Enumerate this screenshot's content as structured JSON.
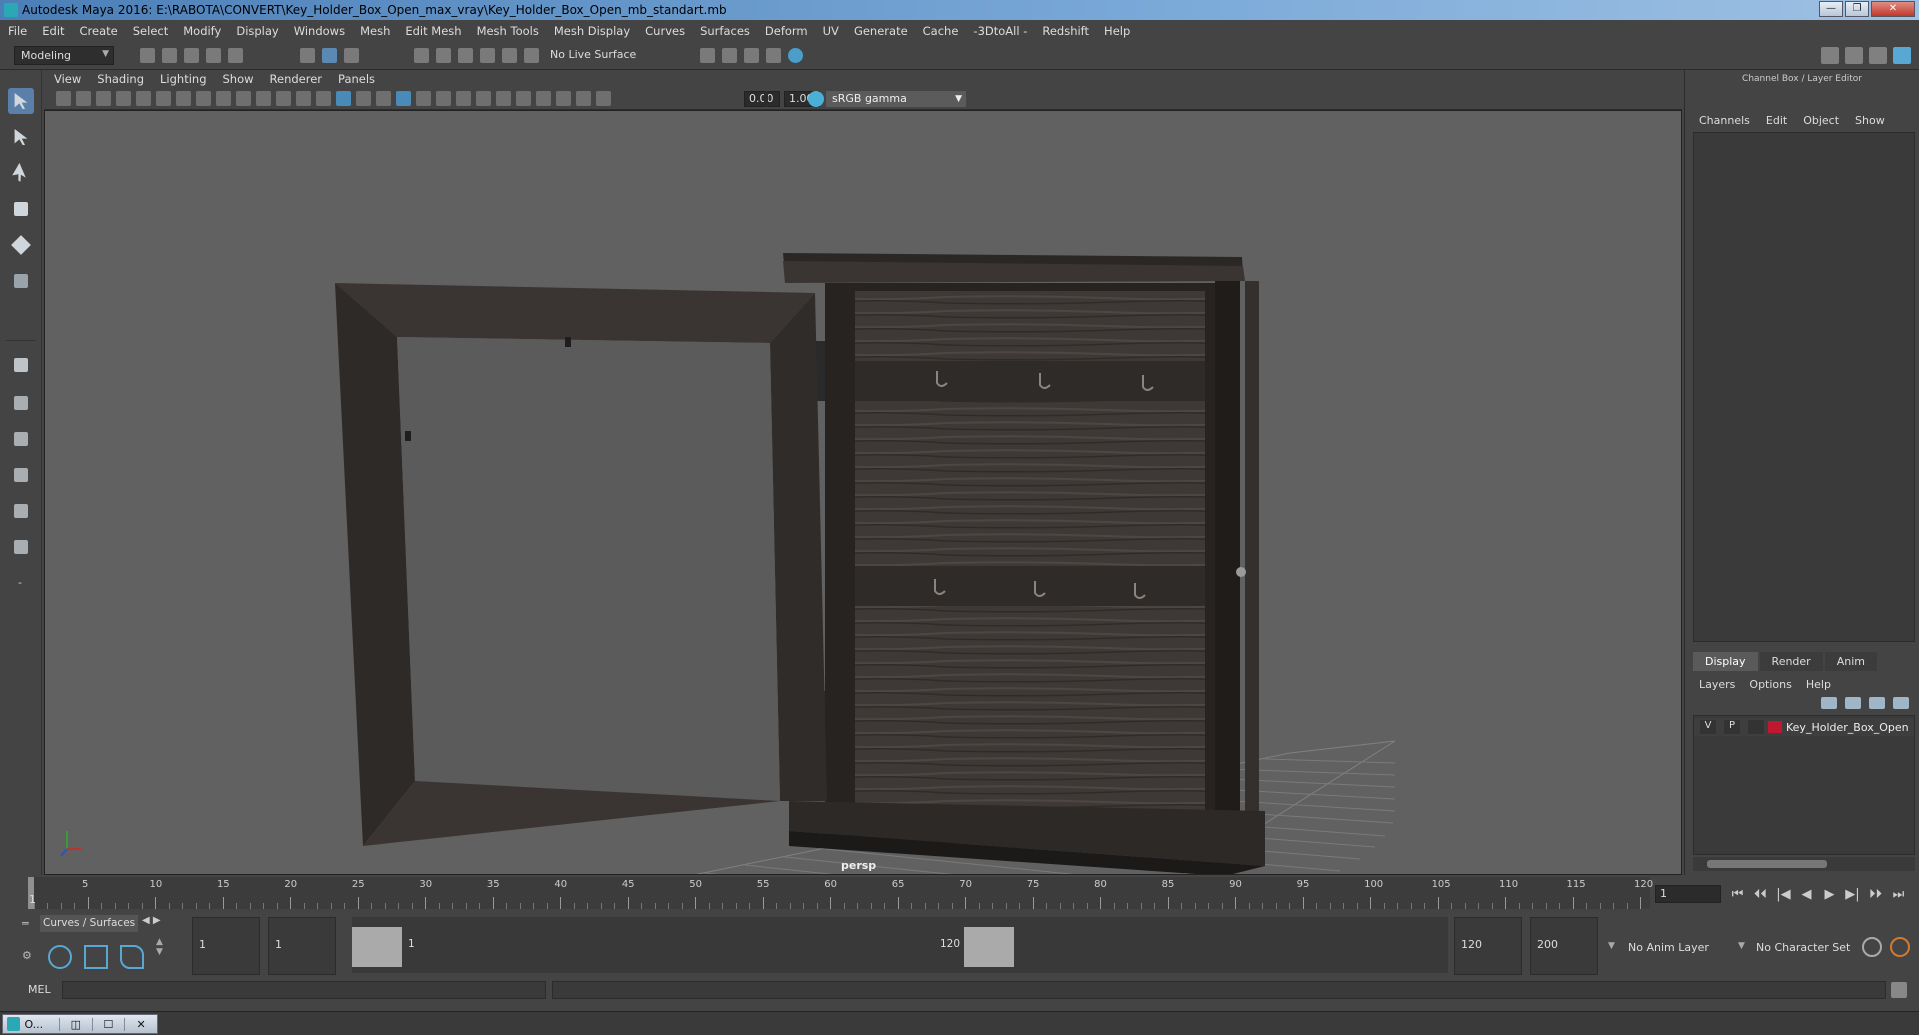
{
  "window": {
    "title": "Autodesk Maya 2016: E:\\RABOTA\\CONVERT\\Key_Holder_Box_Open_max_vray\\Key_Holder_Box_Open_mb_standart.mb",
    "minimize_icon": "minimize-icon",
    "maximize_icon": "maximize-icon",
    "close_label": "✕"
  },
  "menubar": [
    "File",
    "Edit",
    "Create",
    "Select",
    "Modify",
    "Display",
    "Windows",
    "Mesh",
    "Edit Mesh",
    "Mesh Tools",
    "Mesh Display",
    "Curves",
    "Surfaces",
    "Deform",
    "UV",
    "Generate",
    "Cache",
    "-3DtoAll -",
    "Redshift",
    "Help"
  ],
  "statusline": {
    "mode": "Modeling",
    "live_surface": "No Live Surface"
  },
  "panel": {
    "menu": [
      "View",
      "Shading",
      "Lighting",
      "Show",
      "Renderer",
      "Panels"
    ],
    "exposure": "0.00",
    "gamma": "1.00",
    "colorspace": "sRGB gamma",
    "camera_label": "persp"
  },
  "channel_box": {
    "title": "Channel Box / Layer Editor",
    "menu": [
      "Channels",
      "Edit",
      "Object",
      "Show"
    ]
  },
  "layer_editor": {
    "tabs": [
      "Display",
      "Render",
      "Anim"
    ],
    "active_tab": "Display",
    "menu": [
      "Layers",
      "Options",
      "Help"
    ],
    "layers": [
      {
        "visible": "V",
        "playback": "P",
        "name": "Key_Holder_Box_Open",
        "color": "#c01830"
      }
    ]
  },
  "timeline": {
    "ticks": [
      "5",
      "10",
      "15",
      "20",
      "25",
      "30",
      "35",
      "40",
      "45",
      "50",
      "55",
      "60",
      "65",
      "70",
      "75",
      "80",
      "85",
      "90",
      "95",
      "100",
      "105",
      "110",
      "115",
      "120"
    ],
    "current_label": "1",
    "current_frame": "1",
    "play_icons": [
      "⏮",
      "⏴⏴",
      "|◀",
      "◀",
      "▶",
      "▶|",
      "⏵⏵",
      "⏭"
    ]
  },
  "range": {
    "shelf_tab": "Curves / Surfaces",
    "start_time": "1",
    "playback_start": "1",
    "slider_start": "1",
    "slider_end": "120",
    "playback_end": "120",
    "end_time": "200",
    "anim_layer": "No Anim Layer",
    "character_set": "No Character Set"
  },
  "command_line": {
    "label": "MEL"
  },
  "taskbar": {
    "app_label": "O...",
    "restore": "◫",
    "maximize": "☐",
    "close": "✕"
  },
  "colors": {
    "accent": "#59a8d4",
    "viewport_bg": "#616161",
    "layer_red": "#c01830"
  }
}
